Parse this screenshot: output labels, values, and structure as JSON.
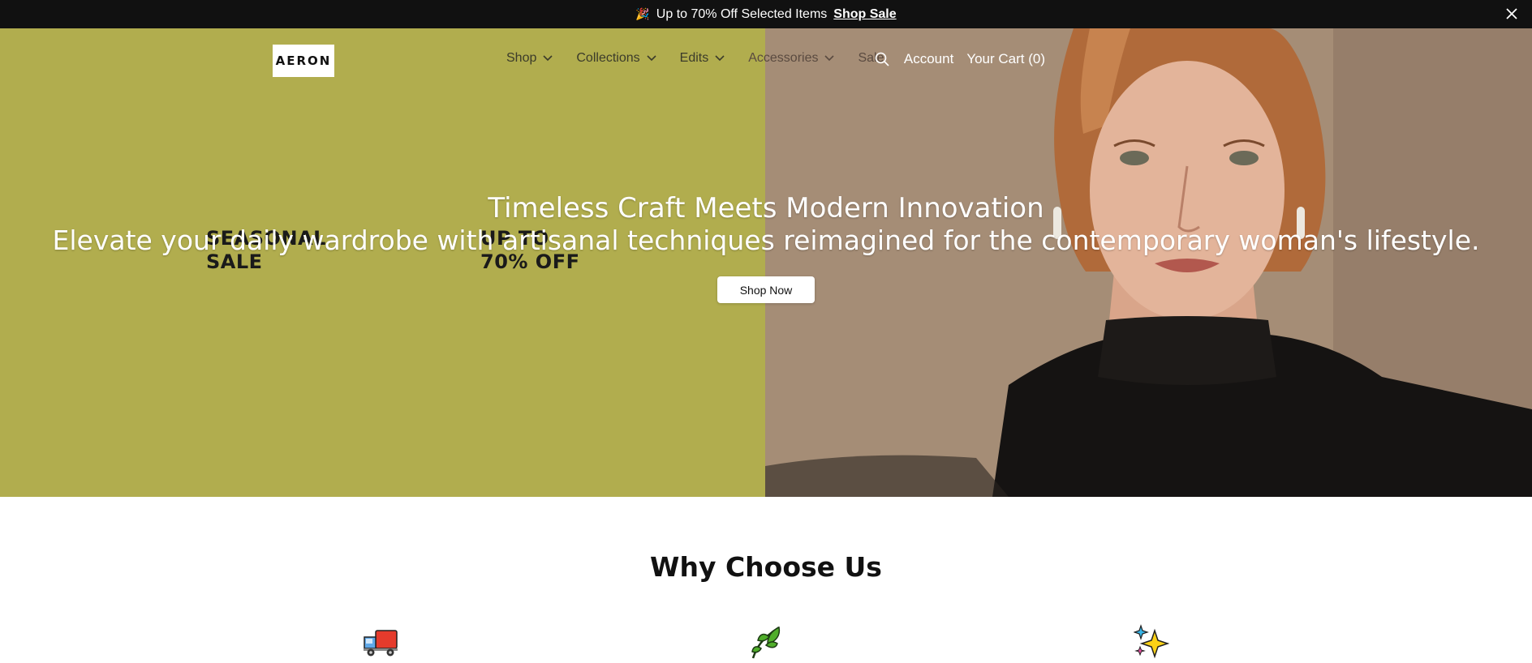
{
  "announcement": {
    "emoji": "🎉",
    "message": "Up to 70% Off Selected Items",
    "link_label": "Shop Sale",
    "close_icon": "close-icon"
  },
  "nav": {
    "logo": "AERON",
    "menu": [
      {
        "label": "Shop",
        "has_dropdown": true
      },
      {
        "label": "Collections",
        "has_dropdown": true
      },
      {
        "label": "Edits",
        "has_dropdown": true
      },
      {
        "label": "Accessories",
        "has_dropdown": true
      },
      {
        "label": "Sale",
        "has_dropdown": false
      }
    ],
    "search_icon": "search-icon",
    "account_label": "Account",
    "cart_label": "Your Cart (0)"
  },
  "hero": {
    "promo_left": [
      "SEASONAL",
      "SALE"
    ],
    "promo_right": [
      "UP TO",
      "70% OFF"
    ],
    "headline": "Timeless Craft Meets Modern Innovation",
    "subhead": "Elevate your daily wardrobe with artisanal techniques reimagined for the contemporary woman's lifestyle.",
    "cta_label": "Shop Now",
    "colors": {
      "left_panel": "#b1ad4e"
    }
  },
  "why": {
    "title": "Why Choose Us",
    "icons": [
      "delivery-truck-icon",
      "leaf-icon",
      "sparkles-icon"
    ]
  }
}
